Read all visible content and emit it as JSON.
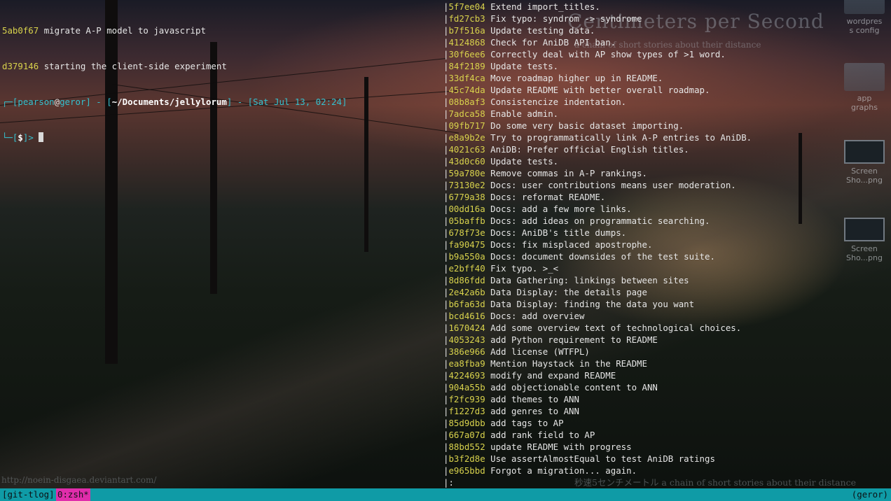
{
  "terminal": {
    "left_pane": {
      "log_lines": [
        {
          "hash": "5ab0f67",
          "message": "migrate A-P model to javascript"
        },
        {
          "hash": "d379146",
          "message": "starting the client-side experiment"
        }
      ],
      "prompt": {
        "prefix_top": "┌─[",
        "user": "pearson",
        "at": "@",
        "host": "geror",
        "separator1": "] - [",
        "path": "~/Documents/jellylorum",
        "separator2": "] - [",
        "datetime": "Sat Jul 13, 02:24",
        "suffix": "]",
        "prefix_bottom": "└─[",
        "symbol": "$",
        "end": "]>"
      }
    },
    "right_pane": {
      "bar_char": "|",
      "commits": [
        {
          "hash": "5f7ee04",
          "message": "Extend import_titles."
        },
        {
          "hash": "fd27cb3",
          "message": "Fix typo: syndrom -> syndrome"
        },
        {
          "hash": "b7f516a",
          "message": "Update testing data."
        },
        {
          "hash": "4124868",
          "message": "Check for AniDB API ban."
        },
        {
          "hash": "30f6ee6",
          "message": "Correctly deal with AP show types of >1 word."
        },
        {
          "hash": "84f2189",
          "message": "Update tests."
        },
        {
          "hash": "33df4ca",
          "message": "Move roadmap higher up in README."
        },
        {
          "hash": "45c74da",
          "message": "Update README with better overall roadmap."
        },
        {
          "hash": "08b8af3",
          "message": "Consistencize indentation."
        },
        {
          "hash": "7adca58",
          "message": "Enable admin."
        },
        {
          "hash": "09fb717",
          "message": "Do some very basic dataset importing."
        },
        {
          "hash": "e8a9b2e",
          "message": "Try to programmatically link A-P entries to AniDB."
        },
        {
          "hash": "4021c63",
          "message": "AniDB: Prefer official English titles."
        },
        {
          "hash": "43d0c60",
          "message": "Update tests."
        },
        {
          "hash": "59a780e",
          "message": "Remove commas in A-P rankings."
        },
        {
          "hash": "73130e2",
          "message": "Docs: user contributions means user moderation."
        },
        {
          "hash": "6779a38",
          "message": "Docs: reformat README."
        },
        {
          "hash": "00dd16a",
          "message": "Docs: add a few more links."
        },
        {
          "hash": "05baffb",
          "message": "Docs: add ideas on programmatic searching."
        },
        {
          "hash": "678f73e",
          "message": "Docs: AniDB's title dumps."
        },
        {
          "hash": "fa90475",
          "message": "Docs: fix misplaced apostrophe."
        },
        {
          "hash": "b9a550a",
          "message": "Docs: document downsides of the test suite."
        },
        {
          "hash": "e2bff40",
          "message": "Fix typo. >_<"
        },
        {
          "hash": "8d86fdd",
          "message": "Data Gathering: linkings between sites"
        },
        {
          "hash": "2e42a6b",
          "message": "Data Display: the details page"
        },
        {
          "hash": "b6fa63d",
          "message": "Data Display: finding the data you want"
        },
        {
          "hash": "bcd4616",
          "message": "Docs: add overview"
        },
        {
          "hash": "1670424",
          "message": "Add some overview text of technological choices."
        },
        {
          "hash": "4053243",
          "message": "add Python requirement to README"
        },
        {
          "hash": "386e966",
          "message": "Add license (WTFPL)"
        },
        {
          "hash": "ea8fba9",
          "message": "Mention Haystack in the README"
        },
        {
          "hash": "4224693",
          "message": "modify and expand README"
        },
        {
          "hash": "904a55b",
          "message": "add objectionable content to ANN"
        },
        {
          "hash": "f2fc939",
          "message": "add themes to ANN"
        },
        {
          "hash": "f1227d3",
          "message": "add genres to ANN"
        },
        {
          "hash": "85d9dbb",
          "message": "add tags to AP"
        },
        {
          "hash": "667a07d",
          "message": "add rank field to AP"
        },
        {
          "hash": "88bd552",
          "message": "update README with progress"
        },
        {
          "hash": "b3f2d8e",
          "message": "Use assertAlmostEqual to test AniDB ratings"
        },
        {
          "hash": "e965bbd",
          "message": "Forgot a migration... again."
        }
      ],
      "pager_prompt": ":"
    }
  },
  "desktop": {
    "icons": [
      {
        "label1": "wordpres",
        "label2": "s config",
        "icon": "folder-icon"
      },
      {
        "label1": "app",
        "label2": "graphs",
        "icon": "folder-icon"
      },
      {
        "label1": "Screen",
        "label2": "Sho...png",
        "icon": "screenshot-icon"
      },
      {
        "label1": "Screen",
        "label2": "Sho...png",
        "icon": "screenshot-icon"
      }
    ]
  },
  "wallpaper": {
    "title": "Centimeters per Second",
    "subtitle": "a chain of short stories about their distance",
    "credit": "http://noein-disgaea.deviantart.com/",
    "bottom_caption": "秒速5センチメートル a chain of short stories about their distance"
  },
  "tmux": {
    "session": "[git-tlog]",
    "window": "0:zsh*",
    "host": "(geror)"
  },
  "colors": {
    "hash": "#d8d24c",
    "prompt_accent": "#35c1cf",
    "statusbar": "#0f9ba6",
    "active_window": "#e02dab"
  }
}
